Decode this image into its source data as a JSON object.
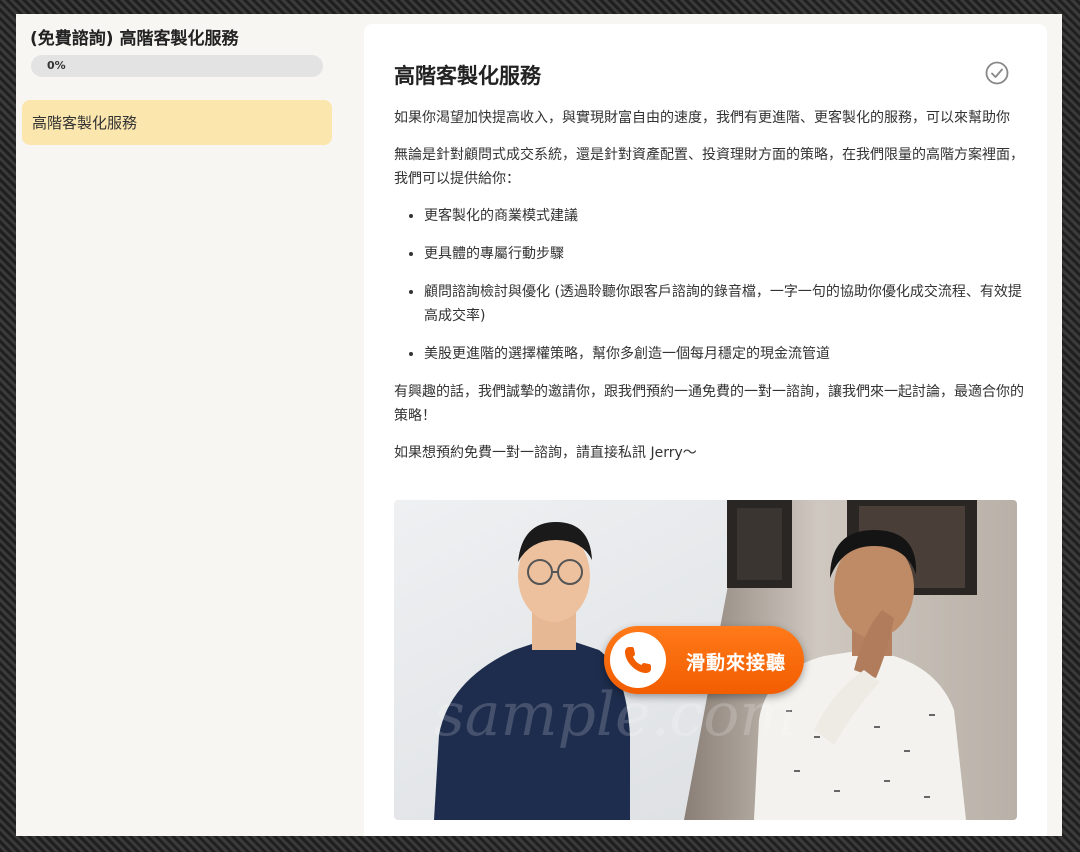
{
  "sidebar": {
    "course_title": "(免費諮詢) 高階客製化服務",
    "progress": {
      "label": "0%",
      "value": 0
    },
    "lessons": [
      {
        "label": "高階客製化服務",
        "active": true
      }
    ]
  },
  "lesson": {
    "title": "高階客製化服務",
    "complete_icon": "check-circle-icon",
    "paragraphs": [
      "如果你渴望加快提高收入，與實現財富自由的速度，我們有更進階、更客製化的服務，可以來幫助你",
      "無論是針對顧問式成交系統，還是針對資產配置、投資理財方面的策略，在我們限量的高階方案裡面，我們可以提供給你："
    ],
    "bullets": [
      "更客製化的商業模式建議",
      "更具體的專屬行動步驟",
      "顧問諮詢檢討與優化 (透過聆聽你跟客戶諮詢的錄音檔，一字一句的協助你優化成交流程、有效提高成交率)",
      "美股更進階的選擇權策略，幫你多創造一個每月穩定的現金流管道"
    ],
    "closing": [
      "有興趣的話，我們誠摯的邀請你，跟我們預約一通免費的一對一諮詢，讓我們來一起討論，最適合你的策略！",
      "如果想預約免費一對一諮詢，請直接私訊 Jerry～"
    ],
    "banner": {
      "call_text": "滑動來接聽",
      "call_icon": "phone-icon",
      "watermark": "sample.com"
    }
  },
  "colors": {
    "accent": "#f4c542",
    "active_item": "#fbe6ae",
    "call_orange": "#f25d00"
  }
}
